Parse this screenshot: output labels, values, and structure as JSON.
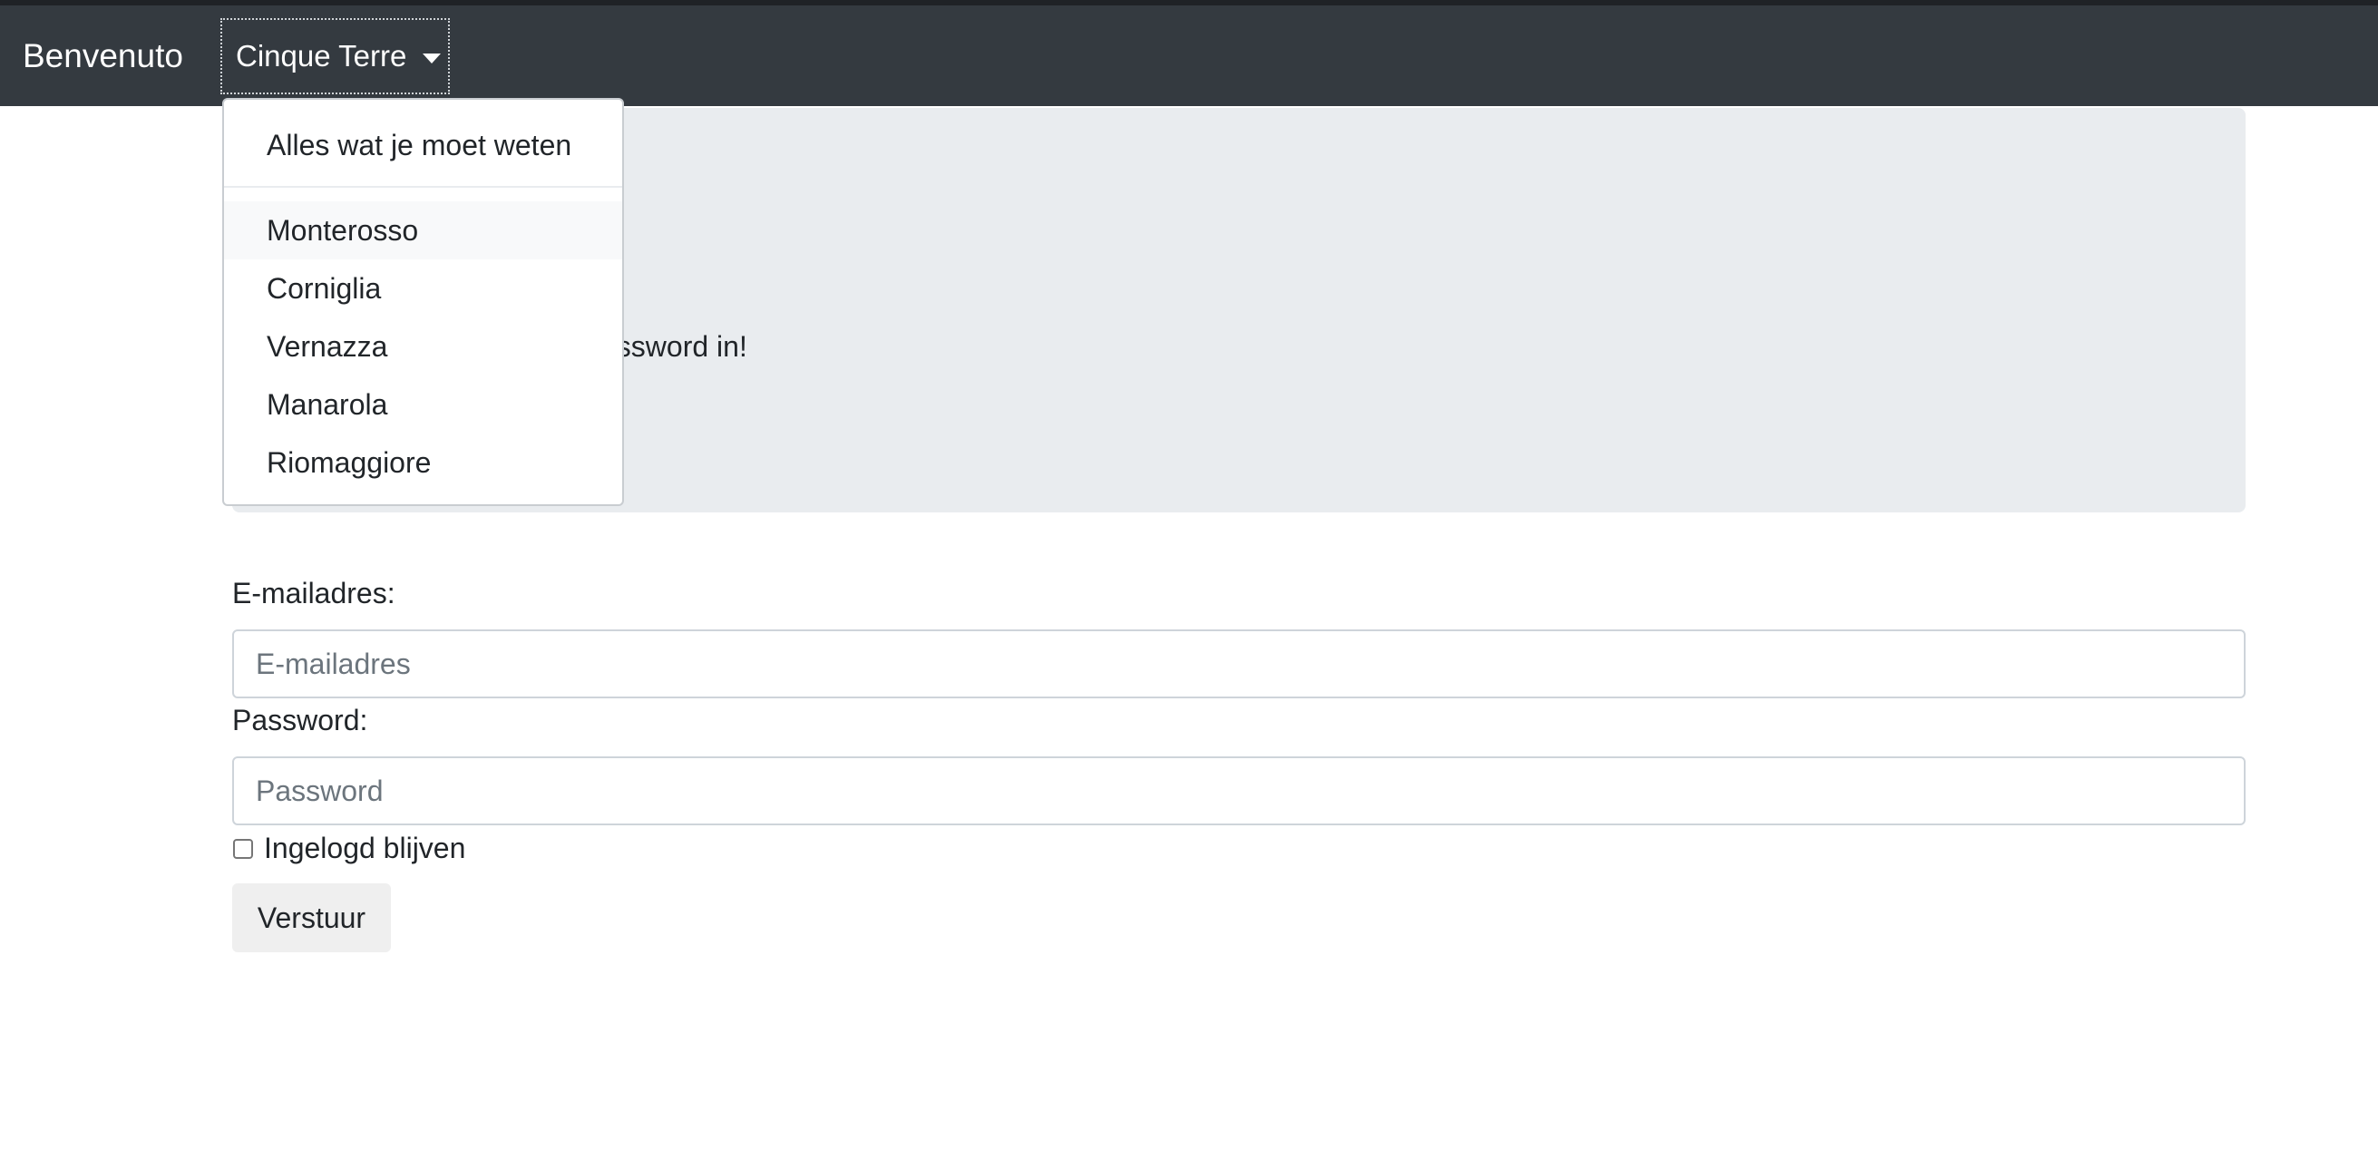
{
  "navbar": {
    "brand": "Benvenuto",
    "dropdown_label": "Cinque Terre"
  },
  "dropdown_menu": {
    "header_item": "Alles wat je moet weten",
    "items": [
      {
        "label": "Monterosso",
        "active": true
      },
      {
        "label": "Corniglia",
        "active": false
      },
      {
        "label": "Vernazza",
        "active": false
      },
      {
        "label": "Manarola",
        "active": false
      },
      {
        "label": "Riomaggiore",
        "active": false
      }
    ]
  },
  "jumbotron": {
    "visible_text": "assword in!"
  },
  "form": {
    "email_label": "E-mailadres:",
    "email_placeholder": "E-mailadres",
    "email_value": "",
    "password_label": "Password:",
    "password_placeholder": "Password",
    "password_value": "",
    "remember_label": "Ingelogd blijven",
    "remember_checked": false,
    "submit_label": "Verstuur"
  },
  "colors": {
    "navbar_bg": "#343a40",
    "jumbotron_bg": "#e9ecef",
    "button_bg": "#efefef"
  }
}
